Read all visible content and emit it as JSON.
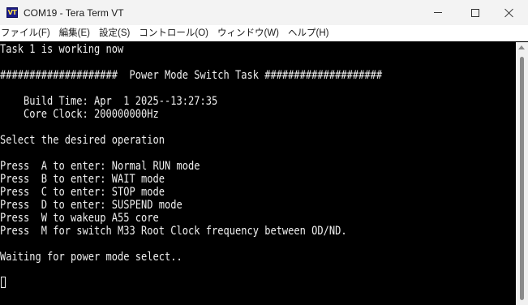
{
  "window": {
    "icon_text": "VT",
    "title": "COM19 - Tera Term VT"
  },
  "menu": [
    {
      "label": "ファイル(F)"
    },
    {
      "label": "編集(E)"
    },
    {
      "label": "設定(S)"
    },
    {
      "label": "コントロール(O)"
    },
    {
      "label": "ウィンドウ(W)"
    },
    {
      "label": "ヘルプ(H)"
    }
  ],
  "terminal": {
    "lines": [
      "Task 1 is working now",
      "",
      "####################  Power Mode Switch Task ####################",
      "",
      "    Build Time: Apr  1 2025--13:27:35",
      "    Core Clock: 200000000Hz",
      "",
      "Select the desired operation",
      "",
      "Press  A to enter: Normal RUN mode",
      "Press  B to enter: WAIT mode",
      "Press  C to enter: STOP mode",
      "Press  D to enter: SUSPEND mode",
      "Press  W to wakeup A55 core",
      "Press  M for switch M33 Root Clock frequency between OD/ND.",
      "",
      "Waiting for power mode select.."
    ]
  },
  "colors": {
    "terminal_bg": "#000000",
    "terminal_fg": "#f0f0f0",
    "titlebar_bg": "#f3f3f3"
  }
}
